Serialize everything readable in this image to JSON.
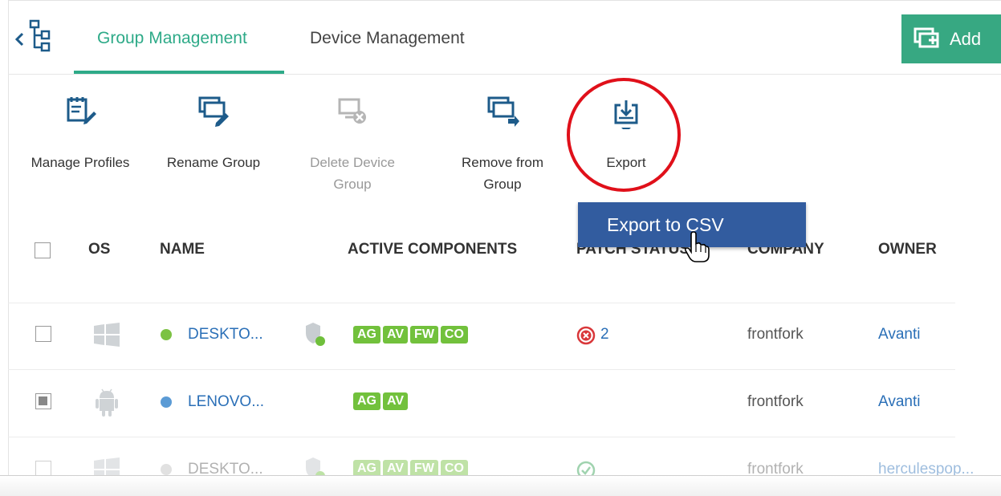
{
  "nav": {
    "tabs": [
      {
        "label": "Group Management",
        "active": true
      },
      {
        "label": "Device Management",
        "active": false
      }
    ],
    "add_label": "Add"
  },
  "toolbar": {
    "manage_profiles": "Manage Profiles",
    "rename_group": "Rename Group",
    "delete_device_group": "Delete Device Group",
    "remove_from_group": "Remove from Group",
    "export": "Export"
  },
  "export_menu": {
    "items": [
      "Export to CSV"
    ]
  },
  "table": {
    "headers": [
      "OS",
      "NAME",
      "ACTIVE COMPONENTS",
      "PATCH STATUS",
      "COMPANY",
      "OWNER"
    ],
    "rows": [
      {
        "os": "windows-icon",
        "status_color": "#7cc243",
        "name": "DESKTO...",
        "components": [
          "AG",
          "AV",
          "FW",
          "CO"
        ],
        "patch": "2",
        "patch_icon": "error-circle-icon",
        "company": "frontfork",
        "owner": "Avanti",
        "checked": false
      },
      {
        "os": "android-icon",
        "status_color": "#5b9bd5",
        "name": "LENOVO...",
        "components": [
          "AG",
          "AV"
        ],
        "patch": "",
        "patch_icon": "",
        "company": "frontfork",
        "owner": "Avanti",
        "checked": true
      },
      {
        "os": "windows-icon",
        "status_color": "#bdbdbd",
        "name": "DESKTO...",
        "components": [
          "AG",
          "AV",
          "FW",
          "CO"
        ],
        "patch": "",
        "patch_icon": "check-circle-icon",
        "company": "frontfork",
        "owner": "herculespop...",
        "checked": false
      }
    ]
  },
  "colors": {
    "accent": "#2eaa88",
    "add_button": "#37a882",
    "menu": "#325c9f",
    "badge": "#72c13c",
    "highlight": "#e0101a",
    "link": "#2a6fb7"
  }
}
